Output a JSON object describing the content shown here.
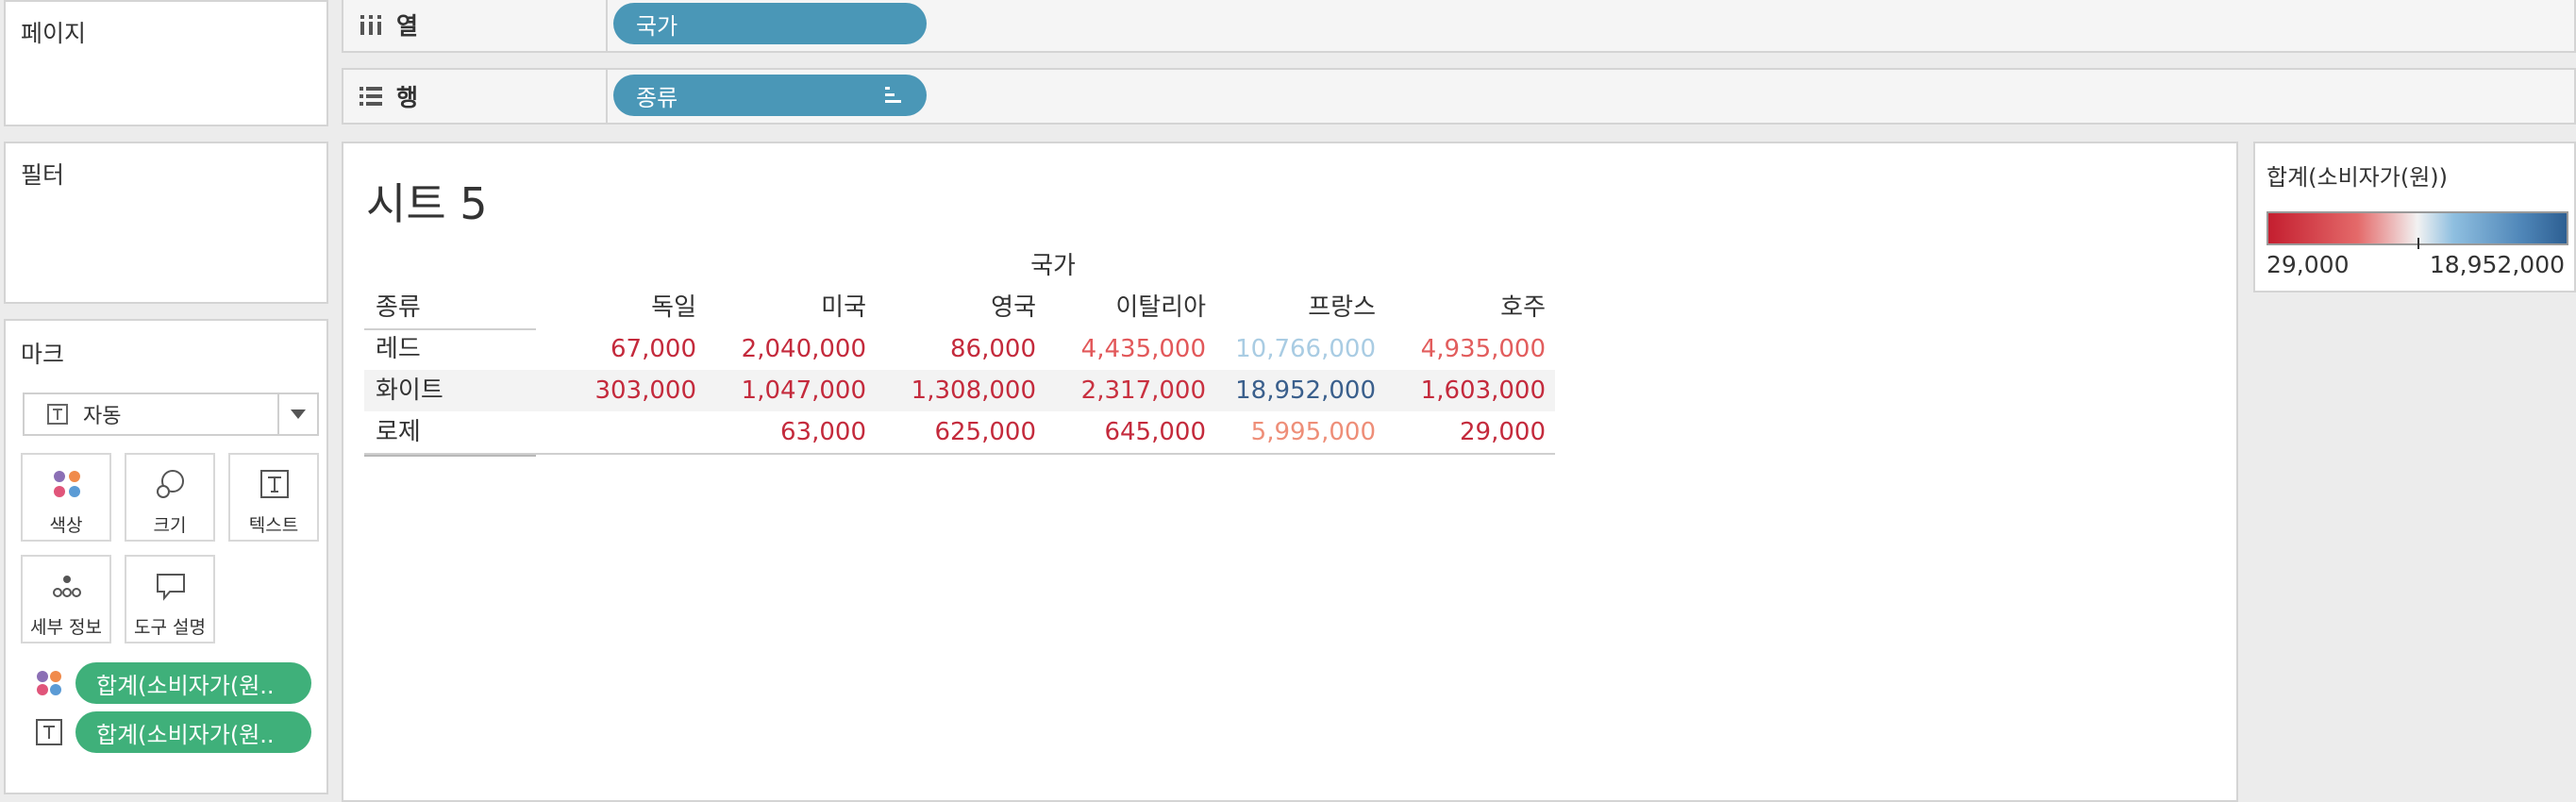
{
  "panels": {
    "pages": "페이지",
    "filters": "필터",
    "marks": "마크"
  },
  "shelves": {
    "columns": {
      "label": "열",
      "pill": "국가"
    },
    "rows": {
      "label": "행",
      "pill": "종류"
    }
  },
  "marks": {
    "type": "자동",
    "buttons": [
      "색상",
      "크기",
      "텍스트",
      "세부 정보",
      "도구 설명"
    ],
    "pills": [
      "합계(소비자가(원..",
      "합계(소비자가(원.."
    ]
  },
  "sheet": {
    "title": "시트 5",
    "column_header": "국가",
    "row_header": "종류",
    "countries": [
      "독일",
      "미국",
      "영국",
      "이탈리아",
      "프랑스",
      "호주"
    ],
    "rows": [
      {
        "type": "레드",
        "values": [
          "67,000",
          "2,040,000",
          "86,000",
          "4,435,000",
          "10,766,000",
          "4,935,000"
        ],
        "colors": [
          "#c42a3c",
          "#c42a3c",
          "#c42a3c",
          "#e2585a",
          "#a9cce3",
          "#e25d5d"
        ]
      },
      {
        "type": "화이트",
        "values": [
          "303,000",
          "1,047,000",
          "1,308,000",
          "2,317,000",
          "18,952,000",
          "1,603,000"
        ],
        "colors": [
          "#c42a3c",
          "#c42a3c",
          "#c42a3c",
          "#c93140",
          "#3a5f8c",
          "#c42a3c"
        ]
      },
      {
        "type": "로제",
        "values": [
          "",
          "63,000",
          "625,000",
          "645,000",
          "5,995,000",
          "29,000"
        ],
        "colors": [
          "#c42a3c",
          "#c42a3c",
          "#c42a3c",
          "#c42a3c",
          "#ee8e78",
          "#c42a3c"
        ]
      }
    ]
  },
  "legend": {
    "title": "합계(소비자가(원))",
    "min": "29,000",
    "max": "18,952,000",
    "colors": {
      "low": "#c41e2f",
      "mid": "#f2f2f2",
      "high": "#2d5f92"
    }
  }
}
